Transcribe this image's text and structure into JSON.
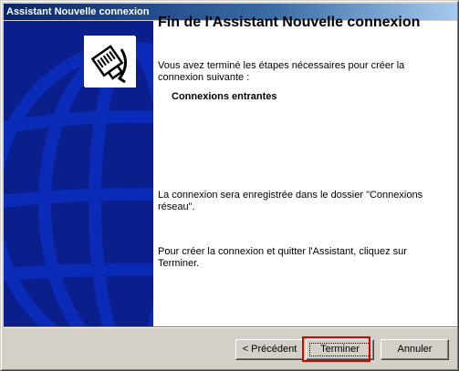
{
  "window": {
    "title": "Assistant Nouvelle connexion"
  },
  "icon": {
    "name": "network-connection-icon"
  },
  "main": {
    "heading": "Fin de l'Assistant Nouvelle connexion",
    "intro": "Vous avez terminé les étapes nécessaires pour créer la connexion suivante :",
    "connection_name": "Connexions entrantes",
    "save_info": "La connexion sera enregistrée dans le dossier \"Connexions réseau\".",
    "finish_info": "Pour créer la connexion et quitter l'Assistant, cliquez sur Terminer."
  },
  "buttons": {
    "previous": "< Précédent",
    "finish": "Terminer",
    "cancel": "Annuler"
  },
  "colors": {
    "side_panel": "#0a1f8c",
    "titlebar_start": "#0a246a",
    "highlight": "#e00000"
  }
}
